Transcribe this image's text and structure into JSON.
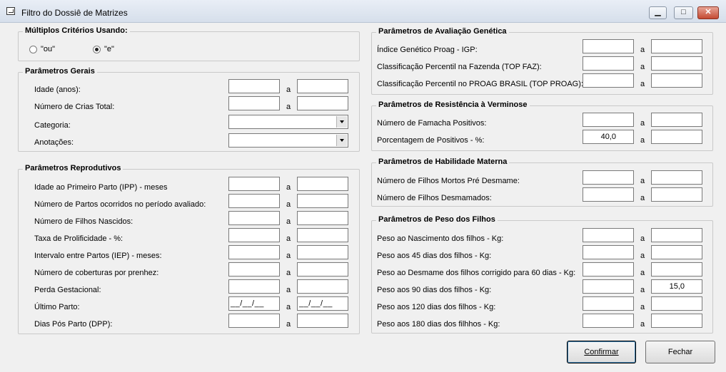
{
  "window": {
    "title": "Filtro do Dossiê de Matrizes",
    "minimize": "▁",
    "maximize": "□",
    "close": "✕"
  },
  "multiplos": {
    "title": "Múltiplos Critérios Usando:",
    "options": [
      {
        "label": "\"ou\"",
        "checked": false
      },
      {
        "label": "\"e\"",
        "checked": true
      }
    ]
  },
  "separator": "a",
  "gerais": {
    "title": "Parâmetros Gerais",
    "idade": "Idade (anos):",
    "crias": "Número de Crias Total:",
    "categoria": "Categoria:",
    "anotacoes": "Anotações:"
  },
  "reprodutivos": {
    "title": "Parâmetros Reprodutivos",
    "rows": [
      {
        "label": "Idade ao Primeiro Parto (IPP) - meses",
        "from": "",
        "to": ""
      },
      {
        "label": "Número de Partos ocorridos no período avaliado:",
        "from": "",
        "to": ""
      },
      {
        "label": "Número de Filhos Nascidos:",
        "from": "",
        "to": ""
      },
      {
        "label": "Taxa de Prolificidade - %:",
        "from": "",
        "to": ""
      },
      {
        "label": "Intervalo entre Partos (IEP) - meses:",
        "from": "",
        "to": ""
      },
      {
        "label": "Número de coberturas por prenhez:",
        "from": "",
        "to": ""
      },
      {
        "label": "Perda Gestacional:",
        "from": "",
        "to": ""
      },
      {
        "label": "Último Parto:",
        "from": "__/__/__",
        "to": "__/__/__"
      },
      {
        "label": "Dias Pós Parto (DPP):",
        "from": "",
        "to": ""
      }
    ]
  },
  "genetica": {
    "title": "Parâmetros de Avaliação Genética",
    "rows": [
      {
        "label": "Índice Genético Proag - IGP:",
        "from": "",
        "to": ""
      },
      {
        "label": "Classificação Percentil na Fazenda (TOP FAZ):",
        "from": "",
        "to": ""
      },
      {
        "label": "Classificação Percentil no PROAG BRASIL (TOP PROAG):",
        "from": "",
        "to": ""
      }
    ]
  },
  "verminose": {
    "title": "Parâmetros de Resistência à Verminose",
    "rows": [
      {
        "label": "Número de Famacha Positivos:",
        "from": "",
        "to": ""
      },
      {
        "label": "Porcentagem de Positivos - %:",
        "from": "40,0",
        "to": ""
      }
    ]
  },
  "materna": {
    "title": "Parâmetros de Habilidade Materna",
    "rows": [
      {
        "label": "Número de Filhos Mortos Pré Desmame:",
        "from": "",
        "to": ""
      },
      {
        "label": "Número de Filhos Desmamados:",
        "from": "",
        "to": ""
      }
    ]
  },
  "peso": {
    "title": "Parâmetros de Peso dos Filhos",
    "rows": [
      {
        "label": "Peso ao Nascimento dos filhos - Kg:",
        "from": "",
        "to": ""
      },
      {
        "label": "Peso aos 45 dias dos filhos - Kg:",
        "from": "",
        "to": ""
      },
      {
        "label": "Peso ao Desmame dos filhos corrigido para 60 dias - Kg:",
        "from": "",
        "to": ""
      },
      {
        "label": "Peso aos 90 dias dos filhos - Kg:",
        "from": "",
        "to": "15,0"
      },
      {
        "label": "Peso aos 120 dias dos filhos - Kg:",
        "from": "",
        "to": ""
      },
      {
        "label": "Peso aos 180 dias dos filhhos - Kg:",
        "from": "",
        "to": ""
      }
    ]
  },
  "buttons": {
    "confirmar": "Confirmar",
    "fechar": "Fechar"
  }
}
